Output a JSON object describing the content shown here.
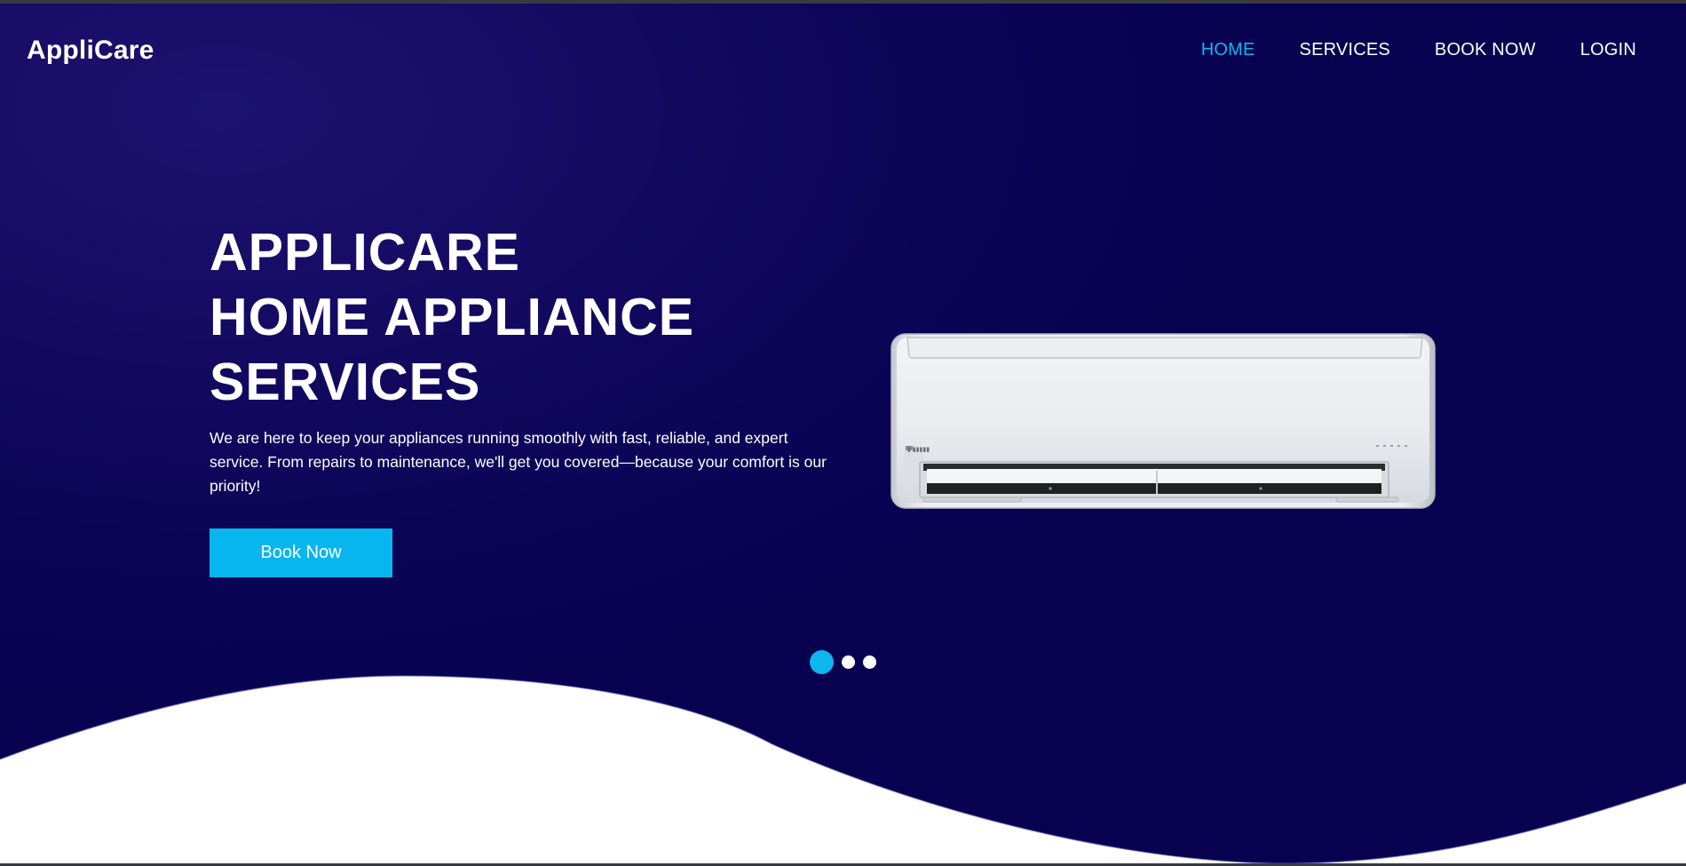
{
  "brand": {
    "name": "AppliCare"
  },
  "nav": {
    "items": [
      {
        "label": "HOME",
        "active": true
      },
      {
        "label": "SERVICES",
        "active": false
      },
      {
        "label": "BOOK NOW",
        "active": false
      },
      {
        "label": "LOGIN",
        "active": false
      }
    ]
  },
  "hero": {
    "title_lines": [
      "APPLICARE",
      "HOME APPLIANCE",
      "SERVICES"
    ],
    "description": "We are here to keep your appliances running smoothly with fast, reliable, and expert service. From repairs to maintenance, we'll get you covered—because your comfort is our priority!",
    "cta_label": "Book Now",
    "image_icon": "air-conditioner-image"
  },
  "carousel": {
    "slide_count": 3,
    "active_index": 0
  },
  "colors": {
    "hero_bg": "#0d0558",
    "accent": "#07b6ef",
    "nav_active": "#11b5ee",
    "text": "#ffffff"
  }
}
